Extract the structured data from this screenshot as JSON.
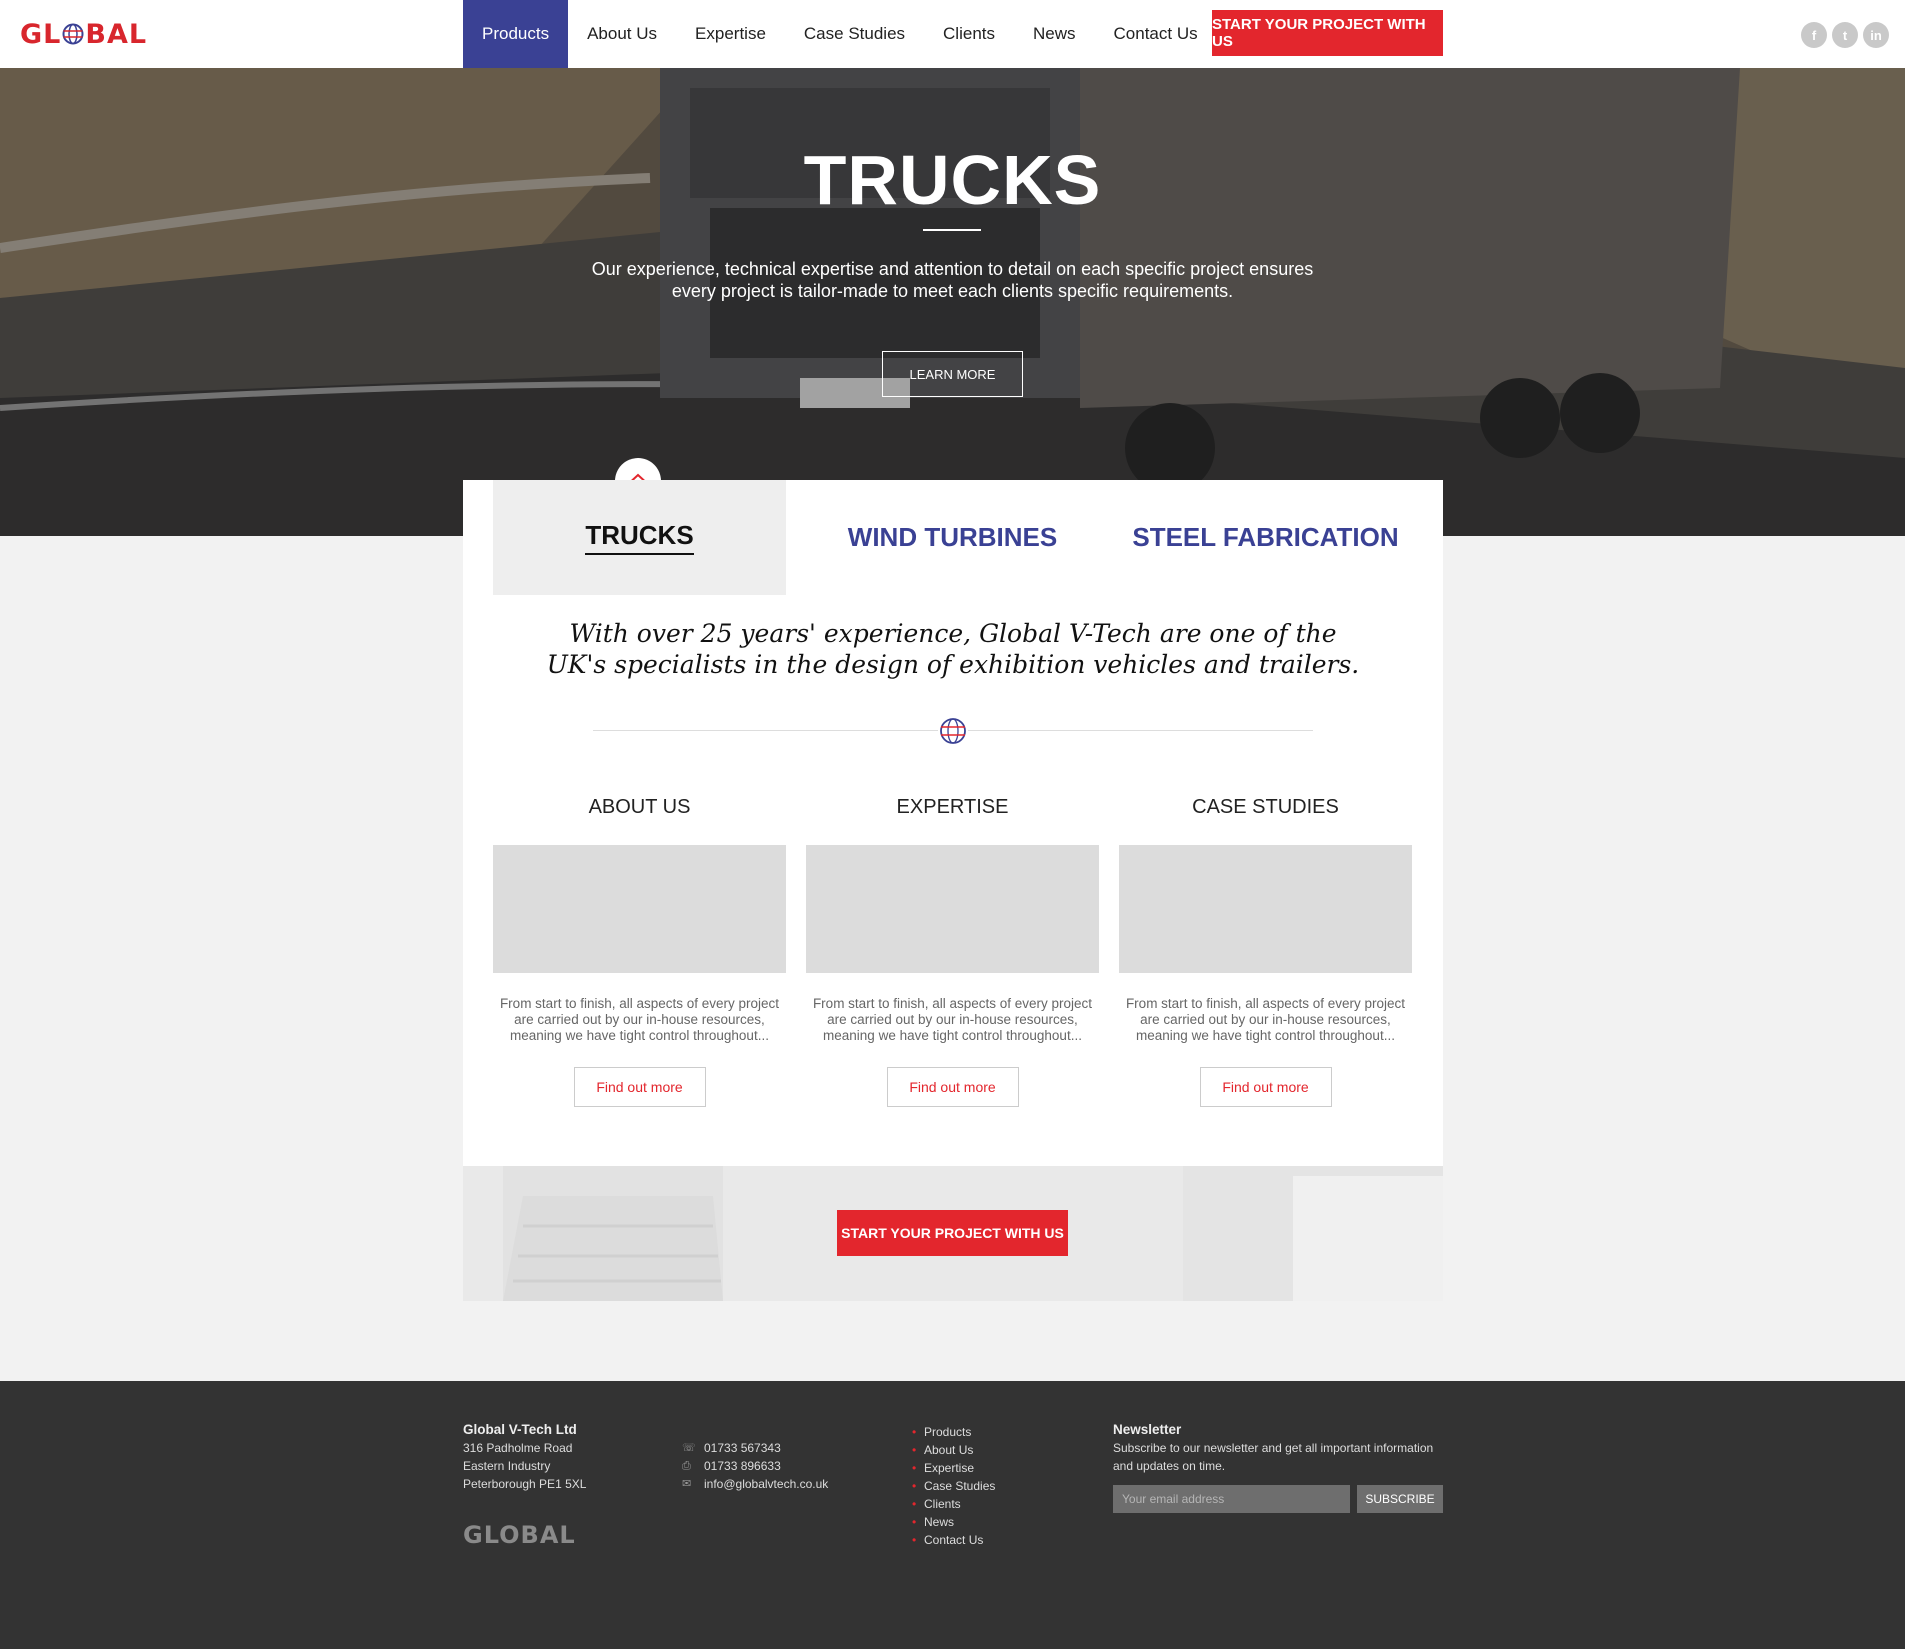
{
  "header": {
    "logo_text": "GLOBAL",
    "nav": [
      {
        "label": "Products",
        "active": true
      },
      {
        "label": "About Us"
      },
      {
        "label": "Expertise"
      },
      {
        "label": "Case Studies"
      },
      {
        "label": "Clients"
      },
      {
        "label": "News"
      },
      {
        "label": "Contact Us"
      }
    ],
    "cta_label": "START YOUR PROJECT WITH US",
    "social": [
      "facebook-icon",
      "twitter-icon",
      "linkedin-icon"
    ]
  },
  "hero": {
    "title": "TRUCKS",
    "subtitle": "Our experience, technical expertise and attention to detail on each specific project ensures every project is tailor-made to meet each clients specific requirements.",
    "button_label": "LEARN MORE"
  },
  "tabs": [
    {
      "label": "TRUCKS",
      "active": true
    },
    {
      "label": "WIND TURBINES"
    },
    {
      "label": "STEEL FABRICATION"
    }
  ],
  "intro_quote": "With over 25 years' experience, Global V-Tech are one of the UK's specialists in the design of exhibition vehicles and trailers.",
  "columns": [
    {
      "title": "ABOUT US",
      "text": "From start to finish, all aspects of every project are carried out by our in-house resources, meaning we have tight control throughout...",
      "button": "Find out more"
    },
    {
      "title": "EXPERTISE",
      "text": "From start to finish, all aspects of every project are carried out by our in-house resources, meaning we have tight control throughout...",
      "button": "Find out more"
    },
    {
      "title": "CASE STUDIES",
      "text": "From start to finish, all aspects of every project are carried out by our in-house resources, meaning we have tight control throughout...",
      "button": "Find out more"
    }
  ],
  "band_cta_label": "START YOUR PROJECT WITH US",
  "footer": {
    "company": "Global V-Tech Ltd",
    "address": [
      "316 Padholme Road",
      "Eastern Industry",
      "Peterborough PE1 5XL"
    ],
    "logo_text": "GLOBAL",
    "phone": "01733 567343",
    "fax": "01733 896633",
    "email": "info@globalvtech.co.uk",
    "links": [
      "Products",
      "About Us",
      "Expertise",
      "Case Studies",
      "Clients",
      "News",
      "Contact Us"
    ],
    "newsletter_title": "Newsletter",
    "newsletter_text": "Subscribe to our newsletter and get all important information and updates on time.",
    "email_placeholder": "Your email address",
    "subscribe_label": "SUBSCRIBE"
  },
  "colors": {
    "brand_red": "#e3262d",
    "brand_blue": "#3a4194",
    "footer_bg": "#333333"
  }
}
